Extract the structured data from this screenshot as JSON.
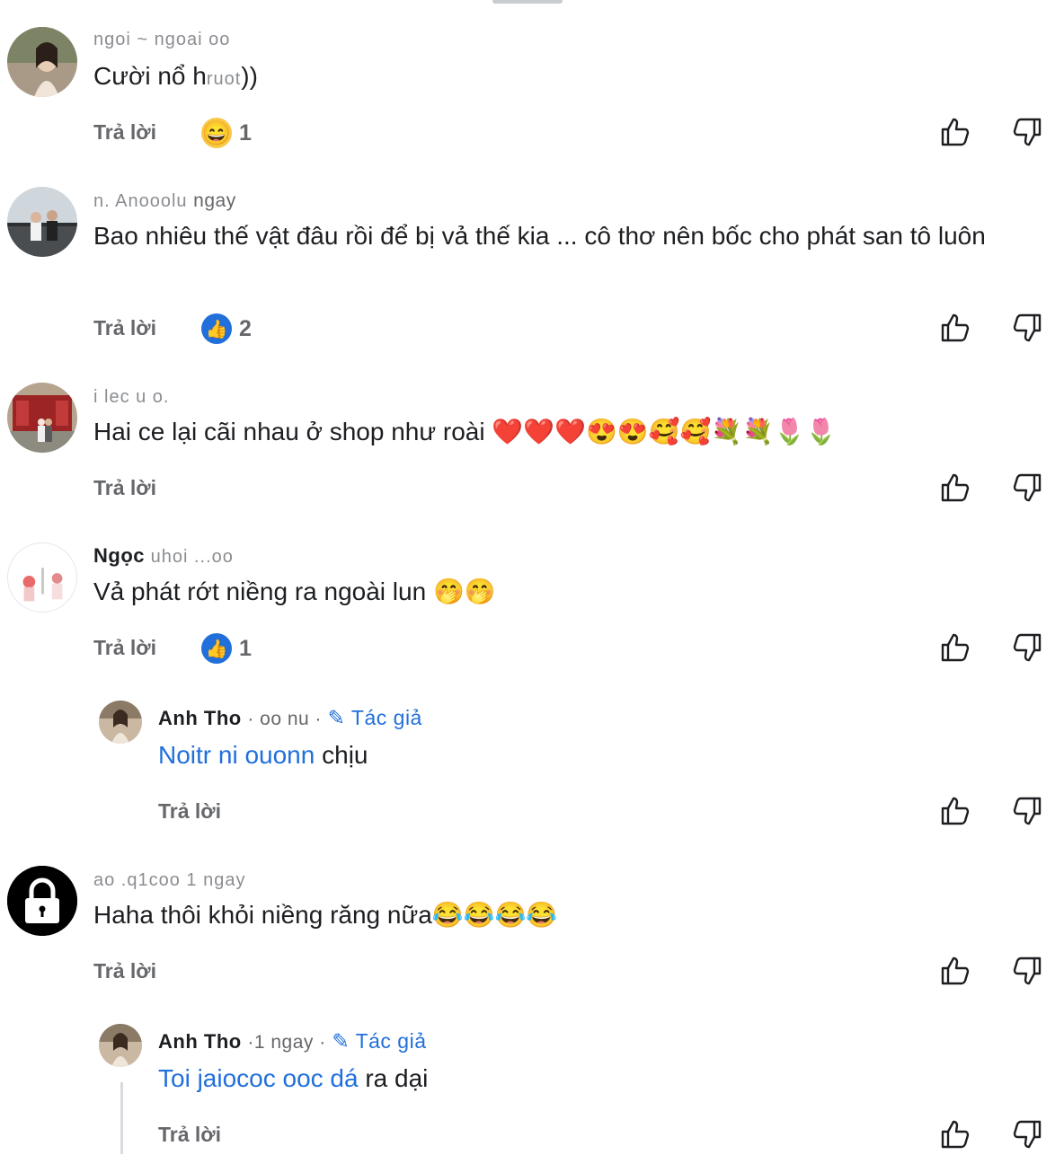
{
  "reply_label": "Trả lời",
  "comments": [
    {
      "name_blur": "ngoi ~ ngoai oo",
      "text": "Cười nổ h",
      "text_blur": "ruot",
      "text_end": "))",
      "reaction_count": "1"
    },
    {
      "name_blur": "n. Anooolu",
      "meta": "ngay",
      "text": "Bao nhiêu thế vật đâu rồi để bị vả thế kia ... cô thơ nên bốc cho phát san tô luôn",
      "reaction_count": "2"
    },
    {
      "name_blur": "i lec   u   o.",
      "text": "Hai ce lại cãi nhau ở shop như roài ❤️❤️❤️😍😍🥰🥰💐💐🌷🌷"
    },
    {
      "name": "Ngọc",
      "name_blur": "uhoi   ...oo",
      "text": "Vả phát rớt niềng ra ngoài lun 🤭🤭",
      "reaction_count": "1"
    },
    {
      "name": "Anh Tho",
      "meta_blur": "· oo nu ·",
      "author": "✎ Tác giả",
      "link_blur": "Noitr ni ouonn",
      "text": " chịu"
    },
    {
      "name_blur": "ao   .q1coo   1 ngay",
      "text": "Haha thôi khỏi niềng răng nữa😂😂😂😂"
    },
    {
      "name": "Anh Tho",
      "meta_blur": "·1 ngay ·",
      "author": "✎ Tác giả",
      "link_blur": "Toi jaiococ ooc dá",
      "text": " ra dại"
    }
  ],
  "colors": {
    "link": "#216fdb",
    "muted": "#65676b",
    "text": "#1c1e21"
  },
  "icons": [
    "thumbs-up-icon",
    "thumbs-down-icon",
    "lock-icon",
    "pencil-icon"
  ]
}
